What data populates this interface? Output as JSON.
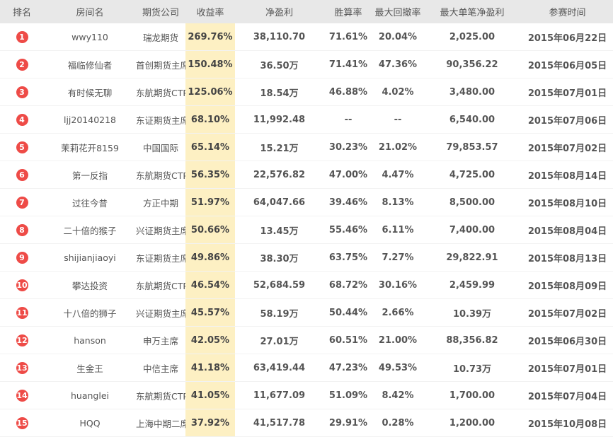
{
  "headers": {
    "rank": "排名",
    "room": "房间名",
    "company": "期货公司",
    "rate": "收益率",
    "profit": "净盈利",
    "winrate": "胜算率",
    "drawdown": "最大回撤率",
    "maxsingle": "最大单笔净盈利",
    "date": "参赛时间"
  },
  "rows": [
    {
      "rank": "1",
      "room": "wwy110",
      "company": "瑞龙期货",
      "rate": "269.76%",
      "profit": "38,110.70",
      "winrate": "71.61%",
      "drawdown": "20.04%",
      "maxsingle": "2,025.00",
      "date": "2015年06月22日"
    },
    {
      "rank": "2",
      "room": "福临修仙者",
      "company": "首创期货主席",
      "rate": "150.48%",
      "profit": "36.50万",
      "winrate": "71.41%",
      "drawdown": "47.36%",
      "maxsingle": "90,356.22",
      "date": "2015年06月05日"
    },
    {
      "rank": "3",
      "room": "有时候无聊",
      "company": "东航期货CTP",
      "rate": "125.06%",
      "profit": "18.54万",
      "winrate": "46.88%",
      "drawdown": "4.02%",
      "maxsingle": "3,480.00",
      "date": "2015年07月01日"
    },
    {
      "rank": "4",
      "room": "ljj20140218",
      "company": "东证期货主席",
      "rate": "68.10%",
      "profit": "11,992.48",
      "winrate": "--",
      "drawdown": "--",
      "maxsingle": "6,540.00",
      "date": "2015年07月06日"
    },
    {
      "rank": "5",
      "room": "茉莉花开8159",
      "company": "中国国际",
      "rate": "65.14%",
      "profit": "15.21万",
      "winrate": "30.23%",
      "drawdown": "21.02%",
      "maxsingle": "79,853.57",
      "date": "2015年07月02日"
    },
    {
      "rank": "6",
      "room": "第一反指",
      "company": "东航期货CTP",
      "rate": "56.35%",
      "profit": "22,576.82",
      "winrate": "47.00%",
      "drawdown": "4.47%",
      "maxsingle": "4,725.00",
      "date": "2015年08月14日"
    },
    {
      "rank": "7",
      "room": "过往今昔",
      "company": "方正中期",
      "rate": "51.97%",
      "profit": "64,047.66",
      "winrate": "39.46%",
      "drawdown": "8.13%",
      "maxsingle": "8,500.00",
      "date": "2015年08月10日"
    },
    {
      "rank": "8",
      "room": "二十倍的猴子",
      "company": "兴证期货主席",
      "rate": "50.66%",
      "profit": "13.45万",
      "winrate": "55.46%",
      "drawdown": "6.11%",
      "maxsingle": "7,400.00",
      "date": "2015年08月04日"
    },
    {
      "rank": "9",
      "room": "shijianjiaoyi",
      "company": "东证期货主席",
      "rate": "49.86%",
      "profit": "38.30万",
      "winrate": "63.75%",
      "drawdown": "7.27%",
      "maxsingle": "29,822.91",
      "date": "2015年08月13日"
    },
    {
      "rank": "10",
      "room": "攀达投资",
      "company": "东航期货CTP",
      "rate": "46.54%",
      "profit": "52,684.59",
      "winrate": "68.72%",
      "drawdown": "30.16%",
      "maxsingle": "2,459.99",
      "date": "2015年08月09日"
    },
    {
      "rank": "11",
      "room": "十八倍的狮子",
      "company": "兴证期货主席",
      "rate": "45.57%",
      "profit": "58.19万",
      "winrate": "50.44%",
      "drawdown": "2.66%",
      "maxsingle": "10.39万",
      "date": "2015年07月02日"
    },
    {
      "rank": "12",
      "room": "hanson",
      "company": "申万主席",
      "rate": "42.05%",
      "profit": "27.01万",
      "winrate": "60.51%",
      "drawdown": "21.00%",
      "maxsingle": "88,356.82",
      "date": "2015年06月30日"
    },
    {
      "rank": "13",
      "room": "生金王",
      "company": "中信主席",
      "rate": "41.18%",
      "profit": "63,419.44",
      "winrate": "47.23%",
      "drawdown": "49.53%",
      "maxsingle": "10.73万",
      "date": "2015年07月01日"
    },
    {
      "rank": "14",
      "room": "huanglei",
      "company": "东航期货CTP",
      "rate": "41.05%",
      "profit": "11,677.09",
      "winrate": "51.09%",
      "drawdown": "8.42%",
      "maxsingle": "1,700.00",
      "date": "2015年07月04日"
    },
    {
      "rank": "15",
      "room": "HQQ",
      "company": "上海中期二席",
      "rate": "37.92%",
      "profit": "41,517.78",
      "winrate": "29.91%",
      "drawdown": "0.28%",
      "maxsingle": "1,200.00",
      "date": "2015年10月08日"
    }
  ],
  "colors": {
    "badge": "#ee4b47",
    "rate_highlight": "#fdf0c3",
    "header_bg": "#e8e8e8"
  }
}
